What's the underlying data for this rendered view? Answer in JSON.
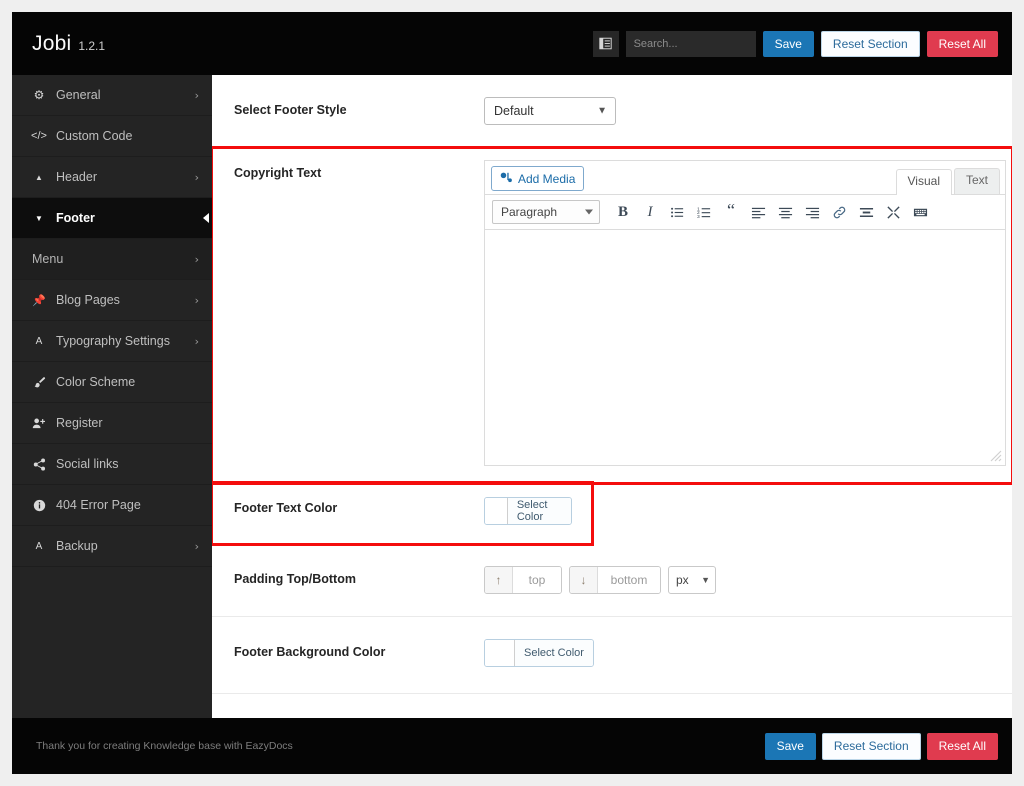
{
  "header": {
    "brand_name": "Jobi",
    "version": "1.2.1",
    "collapse_icon": "collapse-sidebar-icon",
    "search_placeholder": "Search...",
    "search_value": "",
    "save_label": "Save",
    "reset_section_label": "Reset Section",
    "reset_all_label": "Reset All"
  },
  "colors": {
    "header_bg": "#050505",
    "sidebar_bg": "#242424",
    "active_item_bg": "#0d0d0d",
    "save_blue": "#1b76b5",
    "reset_all_red": "#e03b4f",
    "highlight_red": "#f40d0d"
  },
  "sidebar": {
    "items": [
      {
        "label": "General",
        "icon": "gear-icon",
        "arrow": "›",
        "active": false,
        "sub": false
      },
      {
        "label": "Custom Code",
        "icon": "code-icon",
        "arrow": "",
        "active": false,
        "sub": false
      },
      {
        "label": "Header",
        "icon": "caret-up-icon",
        "arrow": "›",
        "active": false,
        "sub": false
      },
      {
        "label": "Footer",
        "icon": "caret-down-icon",
        "arrow": "",
        "active": true,
        "sub": false
      },
      {
        "label": "Menu",
        "icon": "",
        "arrow": "›",
        "active": false,
        "sub": true
      },
      {
        "label": "Blog Pages",
        "icon": "pin-icon",
        "arrow": "›",
        "active": false,
        "sub": false
      },
      {
        "label": "Typography Settings",
        "icon": "text-a-icon",
        "arrow": "›",
        "active": false,
        "sub": false
      },
      {
        "label": "Color Scheme",
        "icon": "brush-icon",
        "arrow": "",
        "active": false,
        "sub": false
      },
      {
        "label": "Register",
        "icon": "user-plus-icon",
        "arrow": "",
        "active": false,
        "sub": false
      },
      {
        "label": "Social links",
        "icon": "share-icon",
        "arrow": "",
        "active": false,
        "sub": false
      },
      {
        "label": "404 Error Page",
        "icon": "info-circle-icon",
        "arrow": "",
        "active": false,
        "sub": false
      },
      {
        "label": "Backup",
        "icon": "text-a-icon",
        "arrow": "›",
        "active": false,
        "sub": false
      }
    ]
  },
  "fields": {
    "footer_style": {
      "label": "Select Footer Style",
      "selected": "Default",
      "options": [
        "Default"
      ]
    },
    "copyright_text": {
      "label": "Copyright Text",
      "add_media_label": "Add Media",
      "add_media_icon": "media-icon",
      "tab_visual": "Visual",
      "tab_text": "Text",
      "format_selected": "Paragraph",
      "format_options": [
        "Paragraph"
      ],
      "toolbar_icons": [
        "bold-icon",
        "italic-icon",
        "bulleted-list-icon",
        "numbered-list-icon",
        "blockquote-icon",
        "align-left-icon",
        "align-center-icon",
        "align-right-icon",
        "link-icon",
        "read-more-icon",
        "fullscreen-icon",
        "keyboard-shortcuts-icon"
      ],
      "content": "",
      "resize_handle_icon": "resize-grip-icon",
      "highlighted": true
    },
    "footer_text_color": {
      "label": "Footer Text Color",
      "select_color_label": "Select Color",
      "swatch": "#ffffff",
      "highlighted": true
    },
    "padding": {
      "label": "Padding Top/Bottom",
      "top_icon": "arrow-up-icon",
      "top_placeholder": "top",
      "top_value": "",
      "bottom_icon": "arrow-down-icon",
      "bottom_placeholder": "bottom",
      "bottom_value": "",
      "unit_selected": "px",
      "unit_options": [
        "px"
      ]
    },
    "footer_background_color": {
      "label": "Footer Background Color",
      "select_color_label": "Select Color",
      "swatch": "#ffffff"
    }
  },
  "footer": {
    "note": "Thank you for creating Knowledge base with EazyDocs",
    "save_label": "Save",
    "reset_section_label": "Reset Section",
    "reset_all_label": "Reset All"
  }
}
